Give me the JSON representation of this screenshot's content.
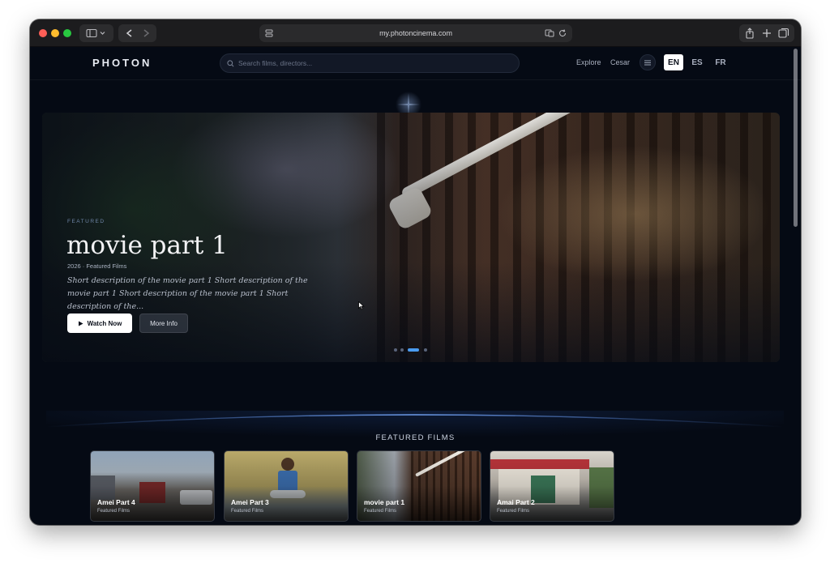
{
  "browser": {
    "url": "my.photoncinema.com"
  },
  "header": {
    "logo": "PHOTON",
    "search_placeholder": "Search films, directors...",
    "nav": [
      "Explore",
      "Cesar"
    ],
    "languages": [
      {
        "code": "EN",
        "active": true
      },
      {
        "code": "ES",
        "active": false
      },
      {
        "code": "FR",
        "active": false
      }
    ]
  },
  "hero": {
    "kicker": "FEATURED",
    "title": "movie part 1",
    "meta": "2026 · Featured Films",
    "description": "Short description of the movie part 1 Short description of the movie part 1 Short description of the movie part 1 Short description of the...",
    "watch_label": "Watch Now",
    "more_label": "More Info",
    "slides_total": 4,
    "slide_active": 3
  },
  "featured": {
    "section_title": "FEATURED FILMS",
    "cards": [
      {
        "title": "Amei Part 4",
        "subtitle": "Featured Films"
      },
      {
        "title": "Amei Part 3",
        "subtitle": "Featured Films"
      },
      {
        "title": "movie part 1",
        "subtitle": "Featured Films"
      },
      {
        "title": "Amai Part 2",
        "subtitle": "Featured Films"
      }
    ]
  },
  "colors": {
    "background": "#050a14",
    "accent": "#4a9cf0"
  }
}
